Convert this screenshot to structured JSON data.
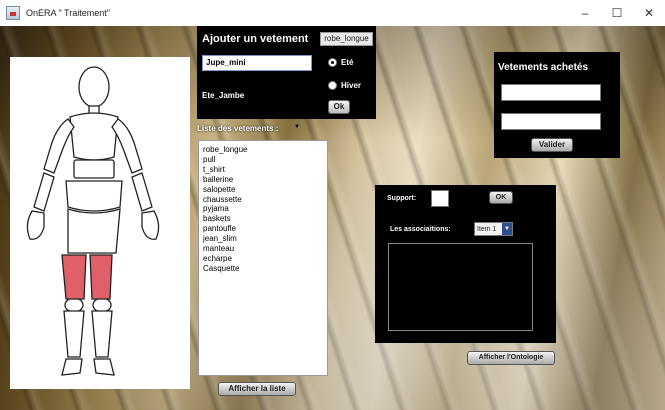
{
  "window": {
    "title": "OnERA \" Traitement\"",
    "minimize": "–",
    "maximize": "☐",
    "close": "✕"
  },
  "figure": {
    "highlighted_zone": "thighs",
    "highlight_color": "#e0606a"
  },
  "add_panel": {
    "title": "Ajouter un vetement",
    "combo_value": "robe_longue",
    "name_value": "Jupe_mini",
    "category": "Ete_Jambe",
    "radio_summer": "Eté",
    "radio_winter": "Hiver",
    "selected_season": "summer",
    "ok": "Ok"
  },
  "clothes_list": {
    "caption": "Liste des vetements :",
    "caret": "▼",
    "items": [
      "robe_longue",
      "pull",
      "t_shirt",
      "ballerine",
      "salopette",
      "chaussette",
      "pyjama",
      "baskets",
      "pantoufle",
      "jean_slim",
      "manteau",
      "echarpe",
      "Casquette"
    ],
    "show_button": "Afficher la liste"
  },
  "bought_panel": {
    "title": "Vetements achetés",
    "field1": "",
    "field2": "",
    "validate": "Valider"
  },
  "assoc_panel": {
    "support_label": "Support:",
    "support_value": "",
    "ok": "OK",
    "assoc_label": "Les associaitions:",
    "select_value": "Item 1",
    "ontology_button": "Afficher l'Ontologie"
  }
}
